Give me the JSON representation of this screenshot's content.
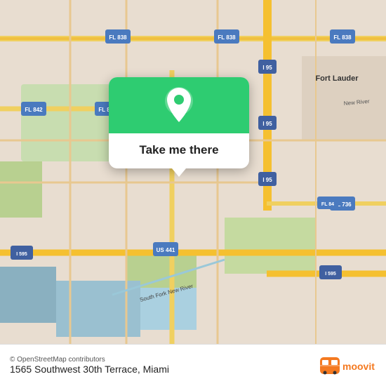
{
  "map": {
    "alt": "Map of Fort Lauderdale area",
    "bg_color": "#e8ddd0"
  },
  "popup": {
    "button_label": "Take me there",
    "icon_bg": "#2ecc71"
  },
  "bottom_bar": {
    "credit": "© OpenStreetMap contributors",
    "address": "1565 Southwest 30th Terrace, Miami",
    "moovit_logo_text": "moovit"
  }
}
